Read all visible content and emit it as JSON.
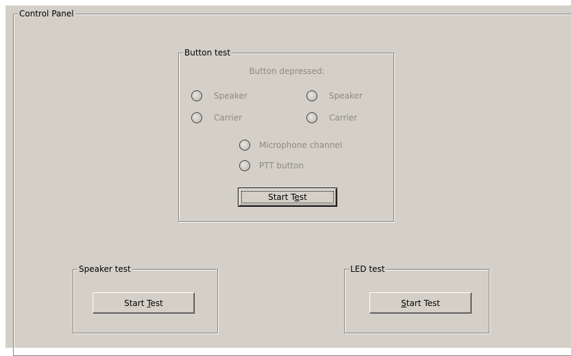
{
  "control_panel": {
    "title": "Control Panel"
  },
  "button_test": {
    "title": "Button test",
    "caption": "Button depressed:",
    "indicators": {
      "left_speaker": "Speaker",
      "right_speaker": "Speaker",
      "left_carrier": "Carrier",
      "right_carrier": "Carrier",
      "microphone": "Microphone channel",
      "ptt": "PTT button"
    },
    "start_button": {
      "pre": "Start T",
      "mnemonic": "e",
      "post": "st"
    }
  },
  "speaker_test": {
    "title": "Speaker test",
    "start_button": {
      "pre": "Start ",
      "mnemonic": "T",
      "post": "est"
    }
  },
  "led_test": {
    "title": "LED test",
    "start_button": {
      "pre": "",
      "mnemonic": "S",
      "post": "tart Test"
    }
  }
}
